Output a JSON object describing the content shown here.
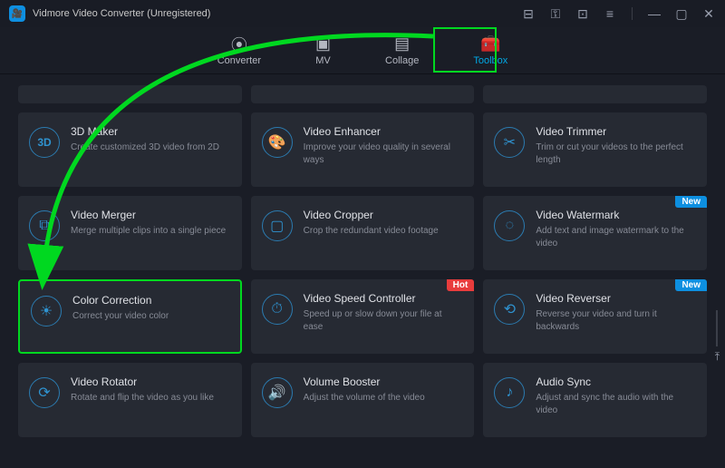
{
  "app": {
    "title": "Vidmore Video Converter (Unregistered)",
    "logo_glyph": "🎥"
  },
  "titlebar_icons": {
    "cart": "⊟",
    "key": "⚿",
    "chat": "⊡",
    "menu": "≡",
    "min": "—",
    "max": "▢",
    "close": "✕"
  },
  "tabs": [
    {
      "id": "converter",
      "label": "Converter",
      "glyph": "⦿"
    },
    {
      "id": "mv",
      "label": "MV",
      "glyph": "▣"
    },
    {
      "id": "collage",
      "label": "Collage",
      "glyph": "▤"
    },
    {
      "id": "toolbox",
      "label": "Toolbox",
      "glyph": "🧰",
      "active": true
    }
  ],
  "badges": {
    "hot": "Hot",
    "new": "New"
  },
  "tools": {
    "row1": [
      {
        "icon": "3D",
        "title": "3D Maker",
        "desc": "Create customized 3D video from 2D"
      },
      {
        "icon": "🎨",
        "title": "Video Enhancer",
        "desc": "Improve your video quality in several ways"
      },
      {
        "icon": "✂",
        "title": "Video Trimmer",
        "desc": "Trim or cut your videos to the perfect length"
      }
    ],
    "row2": [
      {
        "icon": "⧉",
        "title": "Video Merger",
        "desc": "Merge multiple clips into a single piece"
      },
      {
        "icon": "▢",
        "title": "Video Cropper",
        "desc": "Crop the redundant video footage"
      },
      {
        "icon": "◌",
        "title": "Video Watermark",
        "desc": "Add text and image watermark to the video",
        "badge": "new"
      }
    ],
    "row3": [
      {
        "icon": "☀",
        "title": "Color Correction",
        "desc": "Correct your video color",
        "highlight": true
      },
      {
        "icon": "⏱",
        "title": "Video Speed Controller",
        "desc": "Speed up or slow down your file at ease",
        "badge": "hot"
      },
      {
        "icon": "⟲",
        "title": "Video Reverser",
        "desc": "Reverse your video and turn it backwards",
        "badge": "new"
      }
    ],
    "row4": [
      {
        "icon": "⟳",
        "title": "Video Rotator",
        "desc": "Rotate and flip the video as you like"
      },
      {
        "icon": "🔊",
        "title": "Volume Booster",
        "desc": "Adjust the volume of the video"
      },
      {
        "icon": "♪",
        "title": "Audio Sync",
        "desc": "Adjust and sync the audio with the video"
      }
    ]
  },
  "scroll_top_glyph": "⤒"
}
